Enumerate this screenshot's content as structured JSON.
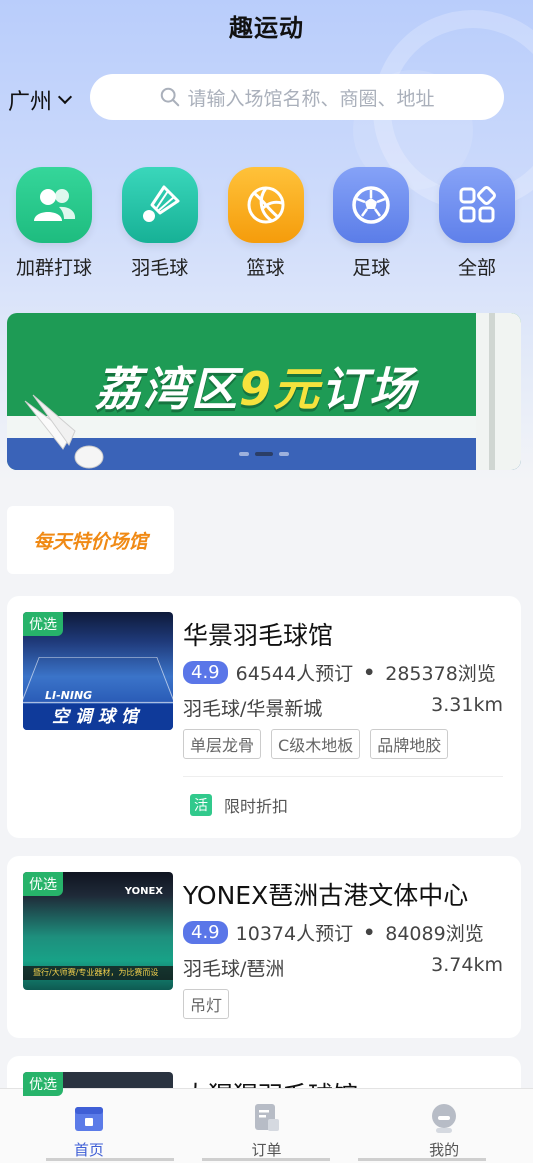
{
  "header": {
    "title": "趣运动"
  },
  "location": {
    "city": "广州"
  },
  "search": {
    "placeholder": "请输入场馆名称、商圈、地址"
  },
  "categories": [
    {
      "label": "加群打球",
      "icon": "group-icon",
      "color": "#27c88f"
    },
    {
      "label": "羽毛球",
      "icon": "shuttlecock-icon",
      "color": "#23c3a6"
    },
    {
      "label": "篮球",
      "icon": "basketball-icon",
      "color": "#fbad14"
    },
    {
      "label": "足球",
      "icon": "soccer-icon",
      "color": "#6d8ff0"
    },
    {
      "label": "全部",
      "icon": "grid-icon",
      "color": "#6f8df0"
    }
  ],
  "banner": {
    "text_pre": "荔湾区",
    "text_num": "9元",
    "text_post": "订场"
  },
  "promo": {
    "label": "每天特价场馆"
  },
  "venues": [
    {
      "tag": "优选",
      "name": "华景羽毛球馆",
      "score": "4.9",
      "bookings": "64544人预订",
      "views": "285378浏览",
      "category": "羽毛球/华景新城",
      "distance": "3.31km",
      "features": [
        "单层龙骨",
        "C级木地板",
        "品牌地胶"
      ],
      "deal_badge": "活",
      "deal": "限时折扣",
      "thumb_caption": "空调球馆",
      "thumb_brand": "LI-NING"
    },
    {
      "tag": "优选",
      "name": "YONEX琶洲古港文体中心",
      "score": "4.9",
      "bookings": "10374人预订",
      "views": "84089浏览",
      "category": "羽毛球/琶洲",
      "distance": "3.74km",
      "features": [
        "吊灯"
      ],
      "thumb_brand": "YONEX",
      "thumb_caption": "暨行/大师赛/专业器材，为比赛而设"
    },
    {
      "tag": "优选",
      "name": "大猩猩羽毛球馆"
    }
  ],
  "tabbar": [
    {
      "label": "首页",
      "icon": "home-icon",
      "active": true
    },
    {
      "label": "订单",
      "icon": "order-icon",
      "active": false
    },
    {
      "label": "我的",
      "icon": "profile-icon",
      "active": false
    }
  ],
  "colors": {
    "accent": "#3f5fd6",
    "tag_green": "#27b36a",
    "score_blue": "#5a76e8",
    "promo_orange": "#f08a15"
  }
}
